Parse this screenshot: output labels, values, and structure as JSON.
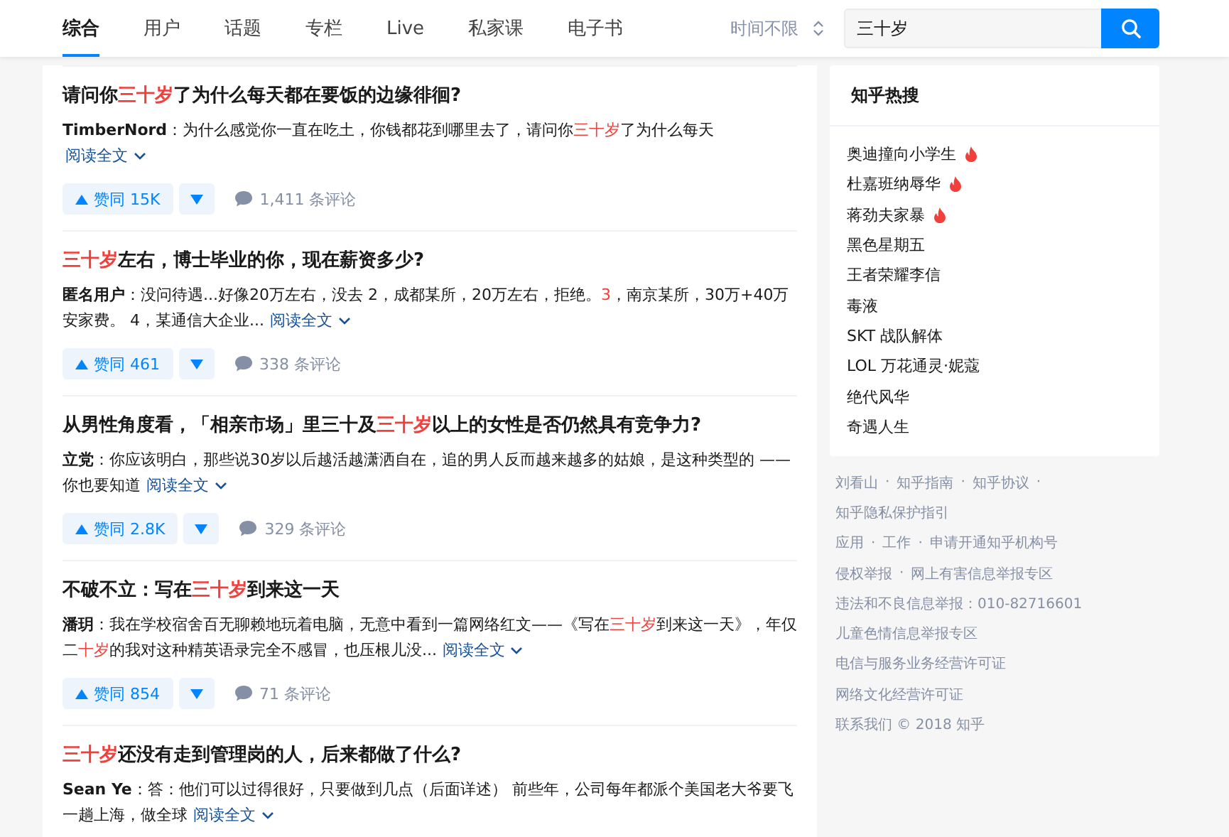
{
  "tabs": [
    {
      "label": "综合",
      "selected": true
    },
    {
      "label": "用户",
      "selected": false
    },
    {
      "label": "话题",
      "selected": false
    },
    {
      "label": "专栏",
      "selected": false
    },
    {
      "label": "Live",
      "selected": false
    },
    {
      "label": "私家课",
      "selected": false
    },
    {
      "label": "电子书",
      "selected": false
    }
  ],
  "time_filter": "时间不限",
  "search": {
    "value": "三十岁"
  },
  "results": [
    {
      "title": [
        {
          "text": "请问你",
          "highlight": false
        },
        {
          "text": "三十岁",
          "highlight": true
        },
        {
          "text": "了为什么每天都在要饭的边缘徘徊?",
          "highlight": false
        }
      ],
      "author": "TimberNord",
      "excerpt": [
        {
          "text": "：为什么感觉你一直在吃土，你钱都花到哪里去了，请问你",
          "highlight": false
        },
        {
          "text": "三十岁",
          "highlight": true
        },
        {
          "text": "了为什么每天",
          "highlight": false
        }
      ],
      "read_more": "阅读全文",
      "read_more_newline": true,
      "votes": "赞同 15K",
      "comments": "1,411 条评论"
    },
    {
      "title": [
        {
          "text": "三十岁",
          "highlight": true
        },
        {
          "text": "左右，博士毕业的你，现在薪资多少?",
          "highlight": false
        }
      ],
      "author": "匿名用户",
      "excerpt": [
        {
          "text": "：没问待遇...好像20万左右，没去 2，成都某所，20万左右，拒绝。",
          "highlight": false
        },
        {
          "text": "3",
          "highlight": true
        },
        {
          "text": "，南京某所，30万+40万安家费。 4，某通信大企业...",
          "highlight": false
        }
      ],
      "read_more": "阅读全文",
      "read_more_newline": false,
      "votes": "赞同 461",
      "comments": "338 条评论"
    },
    {
      "title": [
        {
          "text": "从男性角度看，「相亲市场」里三十及",
          "highlight": false
        },
        {
          "text": "三十岁",
          "highlight": true
        },
        {
          "text": "以上的女性是否仍然具有竞争力?",
          "highlight": false
        }
      ],
      "author": "立党",
      "excerpt": [
        {
          "text": "：你应该明白，那些说30岁以后越活越潇洒自在，追的男人反而越来越多的姑娘，是这种类型的 —— 你也要知道",
          "highlight": false
        }
      ],
      "read_more": "阅读全文",
      "read_more_newline": false,
      "votes": "赞同 2.8K",
      "comments": "329 条评论"
    },
    {
      "title": [
        {
          "text": "不破不立：写在",
          "highlight": false
        },
        {
          "text": "三十岁",
          "highlight": true
        },
        {
          "text": "到来这一天",
          "highlight": false
        }
      ],
      "author": "潘玥",
      "excerpt": [
        {
          "text": "：我在学校宿舍百无聊赖地玩着电脑，无意中看到一篇网络红文——《写在",
          "highlight": false
        },
        {
          "text": "三十岁",
          "highlight": true
        },
        {
          "text": "到来这一天》，年仅二",
          "highlight": false
        },
        {
          "text": "十岁",
          "highlight": true
        },
        {
          "text": "的我对这种精英语录完全不感冒，也压根儿没...",
          "highlight": false
        }
      ],
      "read_more": "阅读全文",
      "read_more_newline": false,
      "votes": "赞同 854",
      "comments": "71 条评论"
    },
    {
      "title": [
        {
          "text": "三十岁",
          "highlight": true
        },
        {
          "text": "还没有走到管理岗的人，后来都做了什么?",
          "highlight": false
        }
      ],
      "author": "Sean Ye",
      "excerpt": [
        {
          "text": "：答：他们可以过得很好，只要做到几点（后面详述） 前些年，公司每年都派个美国老大爷要飞一趟上海，做全球",
          "highlight": false
        }
      ],
      "read_more": "阅读全文",
      "read_more_newline": false
    }
  ],
  "hot_search": {
    "title": "知乎热搜",
    "items": [
      {
        "label": "奥迪撞向小学生",
        "hot": true
      },
      {
        "label": "杜嘉班纳辱华",
        "hot": true
      },
      {
        "label": "蒋劲夫家暴",
        "hot": true
      },
      {
        "label": "黑色星期五",
        "hot": false
      },
      {
        "label": "王者荣耀李信",
        "hot": false
      },
      {
        "label": "毒液",
        "hot": false
      },
      {
        "label": "SKT 战队解体",
        "hot": false
      },
      {
        "label": "LOL 万花通灵·妮蔻",
        "hot": false
      },
      {
        "label": "绝代风华",
        "hot": false
      },
      {
        "label": "奇遇人生",
        "hot": false
      }
    ]
  },
  "footer": {
    "separator": "·",
    "lines": [
      {
        "items": [
          "刘看山",
          "知乎指南",
          "知乎协议"
        ],
        "trailing_separator": true
      },
      {
        "items": [
          "知乎隐私保护指引"
        ],
        "trailing_separator": false
      },
      {
        "items": [
          "应用",
          "工作",
          "申请开通知乎机构号"
        ],
        "trailing_separator": false
      },
      {
        "items": [
          "侵权举报",
          "网上有害信息举报专区"
        ],
        "trailing_separator": false
      },
      {
        "items": [
          "违法和不良信息举报：010-82716601"
        ],
        "trailing_separator": false
      },
      {
        "items": [
          "儿童色情信息举报专区"
        ],
        "trailing_separator": false
      },
      {
        "items": [
          "电信与服务业务经营许可证"
        ],
        "trailing_separator": false
      },
      {
        "items": [
          "网络文化经营许可证"
        ],
        "trailing_separator": false
      },
      {
        "items": [
          "联系我们 © 2018 知乎"
        ],
        "trailing_separator": false
      }
    ]
  }
}
